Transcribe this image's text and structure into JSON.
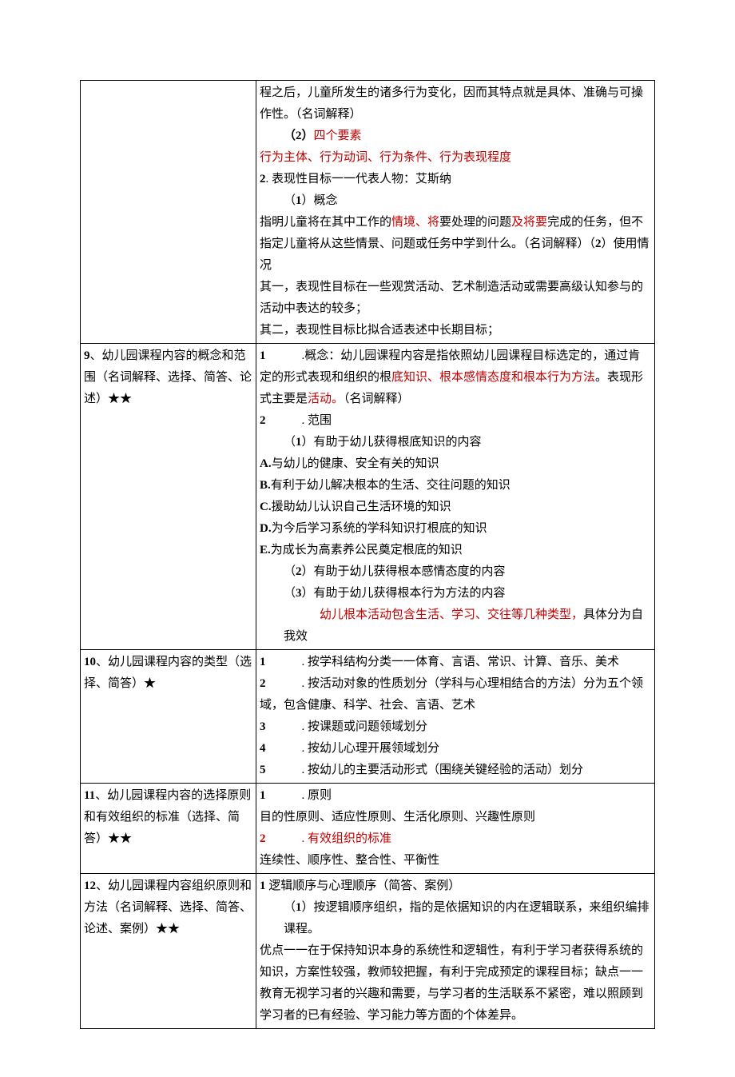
{
  "rows": [
    {
      "left": "",
      "right": {
        "lines": [
          {
            "cls": "p",
            "parts": [
              {
                "t": "程之后，儿童所发生的诸多行为变化，因而其特点就是具体、准确与可操作性。（名词解释）"
              }
            ]
          },
          {
            "cls": "indent1",
            "parts": [
              {
                "t": "（",
                "b": true
              },
              {
                "t": "2",
                "b": true
              },
              {
                "t": "）",
                "b": true
              },
              {
                "t": "四个要素",
                "red": true
              }
            ]
          },
          {
            "cls": "p",
            "parts": [
              {
                "t": "行为主体、行为动词、行为条件、行为表现程度",
                "red": true
              }
            ]
          },
          {
            "cls": "p",
            "parts": [
              {
                "t": "2",
                "b": true
              },
              {
                "t": ". 表现性目标一一代表人物：艾斯纳"
              }
            ]
          },
          {
            "cls": "indent1",
            "parts": [
              {
                "t": "（"
              },
              {
                "t": "1",
                "b": true
              },
              {
                "t": "）概念"
              }
            ]
          },
          {
            "cls": "p",
            "parts": [
              {
                "t": "指明儿童将在其中工作的"
              },
              {
                "t": "情境、将",
                "red": true
              },
              {
                "t": "要处理的问题"
              },
              {
                "t": "及将要",
                "red": true
              },
              {
                "t": "完成的任务，但不指定儿童将从这些情景、问题或任务中学到什么。（名词解释）（"
              },
              {
                "t": "2",
                "b": true
              },
              {
                "t": "）使用情况"
              }
            ]
          },
          {
            "cls": "p",
            "parts": [
              {
                "t": "其一，表现性目标在一些观赏活动、艺术制造活动或需要高级认知参与的活动中表达的较多；"
              }
            ]
          },
          {
            "cls": "p",
            "parts": [
              {
                "t": "其二，表现性目标比拟合适表述中长期目标；"
              }
            ]
          }
        ]
      }
    },
    {
      "left_parts": [
        {
          "t": "9",
          "b": true
        },
        {
          "t": "、幼儿园课程内容的概念和范围（名词解释、选择、简答、论述）★★"
        }
      ],
      "right": {
        "lines": [
          {
            "cls": "p",
            "parts": [
              {
                "t": "1",
                "b": true
              },
              {
                "t": "　　　.概念：幼儿园课程内容是指依照幼儿园课程目标选定的，通过肯定的形式表现和组织的根"
              },
              {
                "t": "底知识、根本感情态度和根本行为方法",
                "red": true
              },
              {
                "t": "。表现形式主要是"
              },
              {
                "t": "活动。",
                "red": true
              },
              {
                "t": "（名词解释）"
              }
            ]
          },
          {
            "cls": "num-line",
            "parts": [
              {
                "t": "2",
                "b": true
              },
              {
                "t": "　　　. 范围"
              }
            ]
          },
          {
            "cls": "indent1",
            "parts": [
              {
                "t": "（"
              },
              {
                "t": "1",
                "b": true
              },
              {
                "t": "）有助于幼儿获得根底知识的内容"
              }
            ]
          },
          {
            "cls": "p",
            "parts": [
              {
                "t": "A.",
                "b": true
              },
              {
                "t": "与幼儿的健康、安全有关的知识"
              }
            ]
          },
          {
            "cls": "p",
            "parts": [
              {
                "t": "B.",
                "b": true
              },
              {
                "t": "有利于幼儿解决根本的生活、交往问题的知识"
              }
            ]
          },
          {
            "cls": "p",
            "parts": [
              {
                "t": "C.",
                "b": true
              },
              {
                "t": "援助幼儿认识自己生活环境的知识"
              }
            ]
          },
          {
            "cls": "p",
            "parts": [
              {
                "t": "D.",
                "b": true
              },
              {
                "t": "为今后学习系统的学科知识打根底的知识"
              }
            ]
          },
          {
            "cls": "p",
            "parts": [
              {
                "t": "E.",
                "b": true
              },
              {
                "t": "为成长为高素养公民奠定根底的知识"
              }
            ]
          },
          {
            "cls": "indent1",
            "parts": [
              {
                "t": "（"
              },
              {
                "t": "2",
                "b": true
              },
              {
                "t": "）有助于幼儿获得根本感情态度的内容"
              }
            ]
          },
          {
            "cls": "indent1",
            "parts": [
              {
                "t": "（"
              },
              {
                "t": "3",
                "b": true
              },
              {
                "t": "）有助于幼儿获得根本行为方法的内容"
              }
            ]
          },
          {
            "cls": "indent1",
            "parts": [
              {
                "t": "　　　"
              },
              {
                "t": "幼儿根本活动包含生活、学习、交往等几种类型，",
                "red": true
              },
              {
                "t": "具体分为自我效"
              }
            ]
          }
        ]
      }
    },
    {
      "left_parts": [
        {
          "t": "10",
          "b": true
        },
        {
          "t": "、幼儿园课程内容的类型（选择、简答）★"
        }
      ],
      "right": {
        "lines": [
          {
            "cls": "num-line",
            "parts": [
              {
                "t": "1",
                "b": true
              },
              {
                "t": "　　　. 按学科结构分类一一体育、言语、常识、计算、音乐、美术"
              }
            ]
          },
          {
            "cls": "num-line",
            "parts": [
              {
                "t": "2",
                "b": true
              },
              {
                "t": "　　　. 按活动对象的性质划分（学科与心理相结合的方法）分为五个领域，包含健康、科学、社会、言语、艺术"
              }
            ]
          },
          {
            "cls": "num-line",
            "parts": [
              {
                "t": "3",
                "b": true
              },
              {
                "t": "　　　. 按课题或问题领域划分"
              }
            ]
          },
          {
            "cls": "num-line",
            "parts": [
              {
                "t": "4",
                "b": true
              },
              {
                "t": "　　　. 按幼儿心理开展领域划分"
              }
            ]
          },
          {
            "cls": "num-line",
            "parts": [
              {
                "t": "5",
                "b": true
              },
              {
                "t": "　　　. 按幼儿的主要活动形式（围绕关键经验的活动）划分"
              }
            ]
          }
        ]
      }
    },
    {
      "left_parts": [
        {
          "t": "11",
          "b": true
        },
        {
          "t": "、幼儿园课程内容的选择原则和有效组织的标准（选择、简答）★★"
        }
      ],
      "right": {
        "lines": [
          {
            "cls": "num-line",
            "parts": [
              {
                "t": "1",
                "b": true
              },
              {
                "t": "　　　. 原则"
              }
            ]
          },
          {
            "cls": "p",
            "parts": [
              {
                "t": "目的性原则、适应性原则、生活化原则、兴趣性原则"
              }
            ]
          },
          {
            "cls": "num-line",
            "parts": [
              {
                "t": "2",
                "b": true,
                "red": true
              },
              {
                "t": "　　　",
                "red": true
              },
              {
                "t": ". 有效组织的标准",
                "red": true
              }
            ]
          },
          {
            "cls": "p",
            "parts": [
              {
                "t": "连续性、顺序性、整合性、平衡性"
              }
            ]
          }
        ]
      }
    },
    {
      "left_parts": [
        {
          "t": "12",
          "b": true
        },
        {
          "t": "、幼儿园课程内容组织原则和方法（名词解释、选择、简答、论述、案例）★★"
        }
      ],
      "right": {
        "lines": [
          {
            "cls": "p",
            "parts": [
              {
                "t": "1",
                "b": true
              },
              {
                "t": " 逻辑顺序与心理顺序（简答、案例）"
              }
            ]
          },
          {
            "cls": "indent1",
            "parts": [
              {
                "t": "（"
              },
              {
                "t": "1",
                "b": true
              },
              {
                "t": "）按逻辑顺序组织，指的是依据知识的内在逻辑联系，来组织编排课程。"
              }
            ]
          },
          {
            "cls": "p",
            "parts": [
              {
                "t": "优点一一在于保持知识本身的系统性和逻辑性，有利于学习者获得系统的知识，方案性较强，教师较把握，有利于完成预定的课程目标；缺点一一教育无视学习者的兴趣和需要，与学习者的生活联系不紧密，难以照顾到学习者的已有经验、学习能力等方面的个体差异。"
              }
            ]
          }
        ]
      }
    }
  ]
}
